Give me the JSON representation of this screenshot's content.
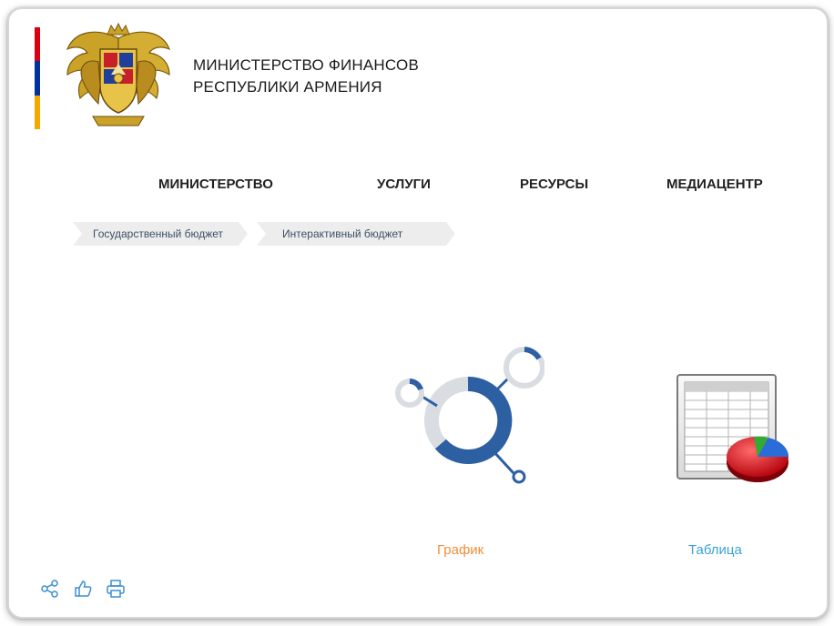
{
  "header": {
    "title_line1": "МИНИСТЕРСТВО ФИНАНСОВ",
    "title_line2": "РЕСПУБЛИКИ АРМЕНИЯ",
    "flag_colors": [
      "#d90012",
      "#0033a0",
      "#f2a800"
    ]
  },
  "nav": {
    "items": [
      {
        "label": "МИНИСТЕРСТВО"
      },
      {
        "label": "УСЛУГИ"
      },
      {
        "label": "РЕСУРСЫ"
      },
      {
        "label": "МЕДИАЦЕНТР"
      }
    ]
  },
  "breadcrumb": {
    "items": [
      {
        "label": "Государственный бюджет"
      },
      {
        "label": "Интерактивный бюджет"
      }
    ]
  },
  "views": {
    "graph": {
      "label": "График",
      "color": "#f28c38",
      "icon": "donut-chart-icon"
    },
    "table": {
      "label": "Таблица",
      "color": "#3aa3d8",
      "icon": "spreadsheet-pie-icon"
    }
  },
  "tools": {
    "icons": [
      "share-icon",
      "like-icon",
      "print-icon"
    ]
  },
  "colors": {
    "accent_blue": "#2d5fa3",
    "ring_gray": "#d9dde2"
  }
}
